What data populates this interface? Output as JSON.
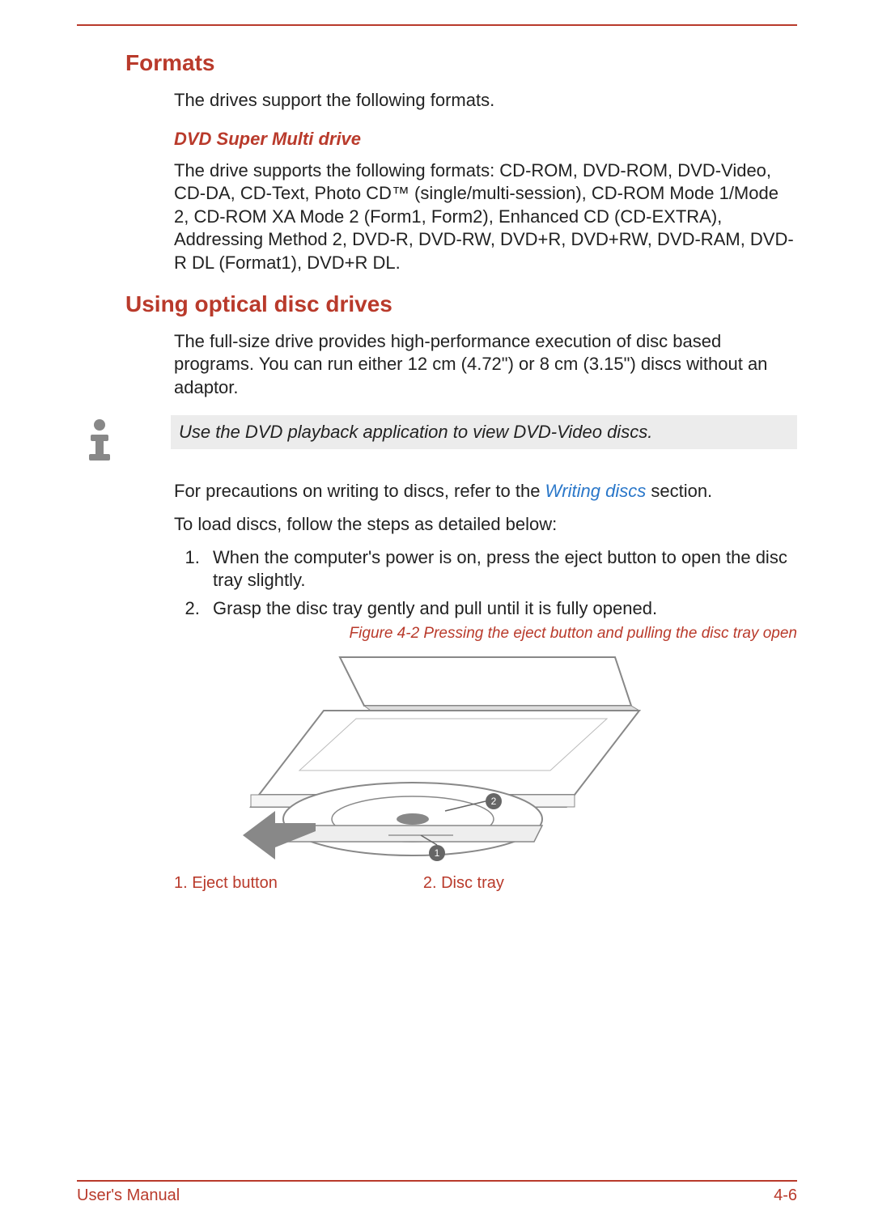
{
  "headings": {
    "formats": "Formats",
    "using_optical": "Using optical disc drives",
    "dvd_super_multi": "DVD Super Multi drive"
  },
  "text": {
    "formats_intro": "The drives support the following formats.",
    "dvd_super_multi_body": "The drive supports the following formats: CD-ROM, DVD-ROM, DVD-Video, CD-DA, CD-Text, Photo CD™ (single/multi-session), CD-ROM Mode 1/Mode 2, CD-ROM XA Mode 2 (Form1, Form2), Enhanced CD (CD-EXTRA), Addressing Method 2, DVD-R, DVD-RW, DVD+R, DVD+RW, DVD-RAM, DVD-R DL (Format1), DVD+R DL.",
    "using_body1": "The full-size drive provides high-performance execution of disc based programs. You can run either 12 cm (4.72\") or 8 cm (3.15\") discs without an adaptor.",
    "note": "Use the DVD playback application to view DVD-Video discs.",
    "precaution_pre": "For precautions on writing to discs, refer to the ",
    "precaution_link": "Writing discs",
    "precaution_post": " section.",
    "to_load": "To load discs, follow the steps as detailed below:",
    "step1": "When the computer's power is on, press the eject button to open the disc tray slightly.",
    "step2": "Grasp the disc tray gently and pull until it is fully opened.",
    "figure_caption": "Figure 4-2 Pressing the eject button and pulling the disc tray open",
    "label1": "1. Eject button",
    "label2": "2. Disc tray"
  },
  "footer": {
    "left": "User's Manual",
    "right": "4-6"
  }
}
